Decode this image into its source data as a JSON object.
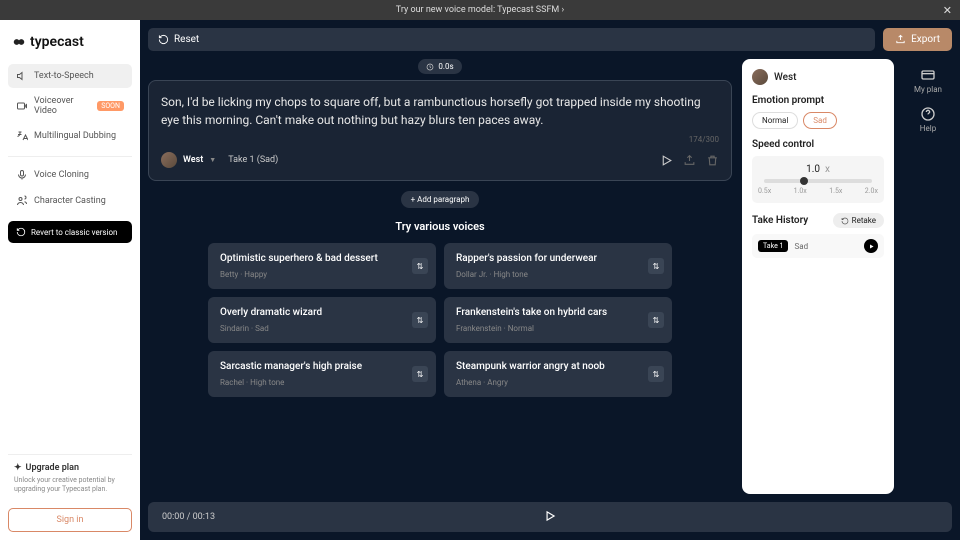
{
  "banner": {
    "text": "Try our new voice model: Typecast SSFM",
    "arrow": "›"
  },
  "brand": "typecast",
  "nav": {
    "tts": "Text-to-Speech",
    "voiceover": "Voiceover Video",
    "voiceover_badge": "SOON",
    "dubbing": "Multilingual Dubbing",
    "cloning": "Voice Cloning",
    "casting": "Character Casting",
    "revert": "Revert to classic version"
  },
  "upgrade": {
    "title": "Upgrade plan",
    "desc": "Unlock your creative potential by upgrading your Typecast plan."
  },
  "signin": "Sign in",
  "toolbar": {
    "reset": "Reset",
    "export": "Export"
  },
  "duration_pill": "0.0s",
  "editor": {
    "text": "Son, I'd be licking my chops to square off, but a rambunctious horsefly got trapped inside my shooting eye this morning. Can't make out nothing but hazy blurs ten paces away.",
    "char_count": "174/300",
    "voice": "West",
    "take": "Take 1 (Sad)"
  },
  "add_paragraph": "+  Add paragraph",
  "voices_heading": "Try various voices",
  "voices": [
    {
      "title": "Optimistic superhero & bad dessert",
      "sub": "Betty · Happy"
    },
    {
      "title": "Rapper's passion for underwear",
      "sub": "Dollar Jr. · High tone"
    },
    {
      "title": "Overly dramatic wizard",
      "sub": "Sindarin · Sad"
    },
    {
      "title": "Frankenstein's take on hybrid cars",
      "sub": "Frankenstein · Normal"
    },
    {
      "title": "Sarcastic manager's high praise",
      "sub": "Rachel · High tone"
    },
    {
      "title": "Steampunk warrior angry at noob",
      "sub": "Athena · Angry"
    }
  ],
  "panel": {
    "voice": "West",
    "emotion_title": "Emotion prompt",
    "emotions": {
      "normal": "Normal",
      "sad": "Sad"
    },
    "speed_title": "Speed control",
    "speed_value": "1.0",
    "speed_unit": "x",
    "speed_labels": {
      "a": "0.5x",
      "b": "1.0x",
      "c": "1.5x",
      "d": "2.0x"
    },
    "history_title": "Take History",
    "retake": "Retake",
    "take_badge": "Take 1",
    "take_emotion": "Sad"
  },
  "icons_col": {
    "plan": "My plan",
    "help": "Help"
  },
  "playbar": {
    "time": "00:00 / 00:13"
  }
}
